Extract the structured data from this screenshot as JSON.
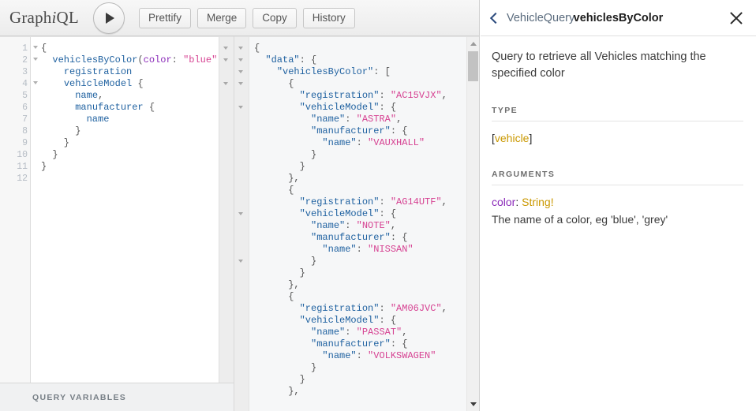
{
  "toolbar": {
    "logo_pre": "Graph",
    "logo_it": "i",
    "logo_post": "QL",
    "execute_label": "Execute Query",
    "buttons": [
      "Prettify",
      "Merge",
      "Copy",
      "History"
    ]
  },
  "query_editor": {
    "line_numbers": [
      "1",
      "2",
      "3",
      "4",
      "5",
      "6",
      "7",
      "8",
      "9",
      "10",
      "11",
      "12"
    ],
    "fold_lines": [
      1,
      2,
      4
    ],
    "lines": [
      [
        {
          "t": "{",
          "c": "punc"
        }
      ],
      [
        {
          "t": "  ",
          "c": "punc"
        },
        {
          "t": "vehiclesByColor",
          "c": "field"
        },
        {
          "t": "(",
          "c": "punc"
        },
        {
          "t": "color",
          "c": "arg"
        },
        {
          "t": ": ",
          "c": "punc"
        },
        {
          "t": "\"blue\"",
          "c": "str"
        },
        {
          "t": ") {",
          "c": "punc"
        }
      ],
      [
        {
          "t": "    ",
          "c": "punc"
        },
        {
          "t": "registration",
          "c": "field"
        }
      ],
      [
        {
          "t": "    ",
          "c": "punc"
        },
        {
          "t": "vehicleModel",
          "c": "field"
        },
        {
          "t": " {",
          "c": "punc"
        }
      ],
      [
        {
          "t": "      ",
          "c": "punc"
        },
        {
          "t": "name",
          "c": "field"
        },
        {
          "t": ",",
          "c": "punc"
        }
      ],
      [
        {
          "t": "      ",
          "c": "punc"
        },
        {
          "t": "manufacturer",
          "c": "field"
        },
        {
          "t": " {",
          "c": "punc"
        }
      ],
      [
        {
          "t": "        ",
          "c": "punc"
        },
        {
          "t": "name",
          "c": "field"
        }
      ],
      [
        {
          "t": "      }",
          "c": "punc"
        }
      ],
      [
        {
          "t": "    }",
          "c": "punc"
        }
      ],
      [
        {
          "t": "  }",
          "c": "punc"
        }
      ],
      [
        {
          "t": "}",
          "c": "punc"
        }
      ],
      []
    ]
  },
  "query_variables": {
    "label": "QUERY VARIABLES"
  },
  "result": {
    "fold_lines": [
      1,
      2,
      3,
      4,
      6,
      15,
      19
    ],
    "lines": [
      [
        {
          "t": "{",
          "c": "punc"
        }
      ],
      [
        {
          "t": "  ",
          "c": "punc"
        },
        {
          "t": "\"data\"",
          "c": "jkey"
        },
        {
          "t": ": {",
          "c": "punc"
        }
      ],
      [
        {
          "t": "    ",
          "c": "punc"
        },
        {
          "t": "\"vehiclesByColor\"",
          "c": "jkey"
        },
        {
          "t": ": [",
          "c": "punc"
        }
      ],
      [
        {
          "t": "      {",
          "c": "punc"
        }
      ],
      [
        {
          "t": "        ",
          "c": "punc"
        },
        {
          "t": "\"registration\"",
          "c": "jkey"
        },
        {
          "t": ": ",
          "c": "punc"
        },
        {
          "t": "\"AC15VJX\"",
          "c": "jstr"
        },
        {
          "t": ",",
          "c": "punc"
        }
      ],
      [
        {
          "t": "        ",
          "c": "punc"
        },
        {
          "t": "\"vehicleModel\"",
          "c": "jkey"
        },
        {
          "t": ": {",
          "c": "punc"
        }
      ],
      [
        {
          "t": "          ",
          "c": "punc"
        },
        {
          "t": "\"name\"",
          "c": "jkey"
        },
        {
          "t": ": ",
          "c": "punc"
        },
        {
          "t": "\"ASTRA\"",
          "c": "jstr"
        },
        {
          "t": ",",
          "c": "punc"
        }
      ],
      [
        {
          "t": "          ",
          "c": "punc"
        },
        {
          "t": "\"manufacturer\"",
          "c": "jkey"
        },
        {
          "t": ": {",
          "c": "punc"
        }
      ],
      [
        {
          "t": "            ",
          "c": "punc"
        },
        {
          "t": "\"name\"",
          "c": "jkey"
        },
        {
          "t": ": ",
          "c": "punc"
        },
        {
          "t": "\"VAUXHALL\"",
          "c": "jstr"
        }
      ],
      [
        {
          "t": "          }",
          "c": "punc"
        }
      ],
      [
        {
          "t": "        }",
          "c": "punc"
        }
      ],
      [
        {
          "t": "      },",
          "c": "punc"
        }
      ],
      [
        {
          "t": "      {",
          "c": "punc"
        }
      ],
      [
        {
          "t": "        ",
          "c": "punc"
        },
        {
          "t": "\"registration\"",
          "c": "jkey"
        },
        {
          "t": ": ",
          "c": "punc"
        },
        {
          "t": "\"AG14UTF\"",
          "c": "jstr"
        },
        {
          "t": ",",
          "c": "punc"
        }
      ],
      [
        {
          "t": "        ",
          "c": "punc"
        },
        {
          "t": "\"vehicleModel\"",
          "c": "jkey"
        },
        {
          "t": ": {",
          "c": "punc"
        }
      ],
      [
        {
          "t": "          ",
          "c": "punc"
        },
        {
          "t": "\"name\"",
          "c": "jkey"
        },
        {
          "t": ": ",
          "c": "punc"
        },
        {
          "t": "\"NOTE\"",
          "c": "jstr"
        },
        {
          "t": ",",
          "c": "punc"
        }
      ],
      [
        {
          "t": "          ",
          "c": "punc"
        },
        {
          "t": "\"manufacturer\"",
          "c": "jkey"
        },
        {
          "t": ": {",
          "c": "punc"
        }
      ],
      [
        {
          "t": "            ",
          "c": "punc"
        },
        {
          "t": "\"name\"",
          "c": "jkey"
        },
        {
          "t": ": ",
          "c": "punc"
        },
        {
          "t": "\"NISSAN\"",
          "c": "jstr"
        }
      ],
      [
        {
          "t": "          }",
          "c": "punc"
        }
      ],
      [
        {
          "t": "        }",
          "c": "punc"
        }
      ],
      [
        {
          "t": "      },",
          "c": "punc"
        }
      ],
      [
        {
          "t": "      {",
          "c": "punc"
        }
      ],
      [
        {
          "t": "        ",
          "c": "punc"
        },
        {
          "t": "\"registration\"",
          "c": "jkey"
        },
        {
          "t": ": ",
          "c": "punc"
        },
        {
          "t": "\"AM06JVC\"",
          "c": "jstr"
        },
        {
          "t": ",",
          "c": "punc"
        }
      ],
      [
        {
          "t": "        ",
          "c": "punc"
        },
        {
          "t": "\"vehicleModel\"",
          "c": "jkey"
        },
        {
          "t": ": {",
          "c": "punc"
        }
      ],
      [
        {
          "t": "          ",
          "c": "punc"
        },
        {
          "t": "\"name\"",
          "c": "jkey"
        },
        {
          "t": ": ",
          "c": "punc"
        },
        {
          "t": "\"PASSAT\"",
          "c": "jstr"
        },
        {
          "t": ",",
          "c": "punc"
        }
      ],
      [
        {
          "t": "          ",
          "c": "punc"
        },
        {
          "t": "\"manufacturer\"",
          "c": "jkey"
        },
        {
          "t": ": {",
          "c": "punc"
        }
      ],
      [
        {
          "t": "            ",
          "c": "punc"
        },
        {
          "t": "\"name\"",
          "c": "jkey"
        },
        {
          "t": ": ",
          "c": "punc"
        },
        {
          "t": "\"VOLKSWAGEN\"",
          "c": "jstr"
        }
      ],
      [
        {
          "t": "          }",
          "c": "punc"
        }
      ],
      [
        {
          "t": "        }",
          "c": "punc"
        }
      ],
      [
        {
          "t": "      },",
          "c": "punc"
        }
      ]
    ]
  },
  "docs": {
    "back_label": "VehicleQuery",
    "title": "vehiclesByColor",
    "description": "Query to retrieve all Vehicles matching the specified color",
    "type_section_label": "TYPE",
    "type_open_bracket": "[",
    "type_name": "vehicle",
    "type_close_bracket": "]",
    "arguments_section_label": "ARGUMENTS",
    "arg_name": "color",
    "arg_sep": ": ",
    "arg_type": "String",
    "arg_required": "!",
    "arg_description": "The name of a color, eg 'blue', 'grey'"
  }
}
